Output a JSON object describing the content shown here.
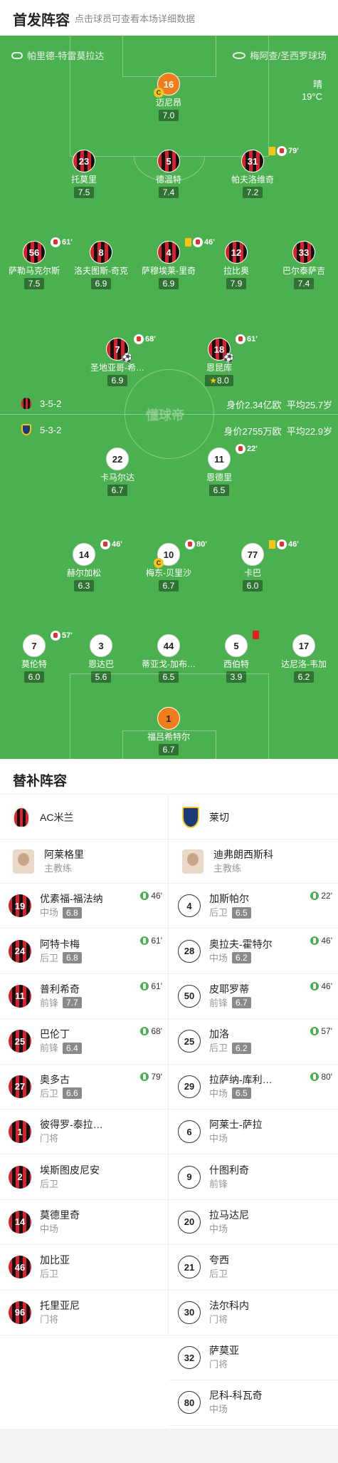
{
  "header": {
    "title": "首发阵容",
    "subtitle": "点击球员可查看本场详细数据"
  },
  "venue": {
    "referee": "帕里德-特雷莫拉达",
    "stadium": "梅阿查/圣西罗球场"
  },
  "weather": {
    "condition": "晴",
    "temp": "19°C"
  },
  "watermark": "懂球帝",
  "teams": {
    "home": {
      "formation": "3-5-2",
      "value": "身价2.34亿欧",
      "age": "平均25.7岁"
    },
    "away": {
      "formation": "5-3-2",
      "value": "身价2755万欧",
      "age": "平均22.9岁"
    }
  },
  "home_players": [
    {
      "num": "16",
      "name": "迈尼昂",
      "rating": "7.0"
    },
    {
      "num": "23",
      "name": "托莫里",
      "rating": "7.5"
    },
    {
      "num": "5",
      "name": "德温特",
      "rating": "7.4"
    },
    {
      "num": "31",
      "name": "帕夫洛维奇",
      "rating": "7.2",
      "min": "79'"
    },
    {
      "num": "56",
      "name": "萨勒马克尔斯",
      "rating": "7.5",
      "min": "61'"
    },
    {
      "num": "8",
      "name": "洛夫图斯-奇克",
      "rating": "6.9"
    },
    {
      "num": "4",
      "name": "萨穆埃莱-里奇",
      "rating": "6.9",
      "min": "46'"
    },
    {
      "num": "12",
      "name": "拉比奥",
      "rating": "7.9"
    },
    {
      "num": "33",
      "name": "巴尔泰萨吉",
      "rating": "7.4"
    },
    {
      "num": "7",
      "name": "圣地亚哥-希…",
      "rating": "6.9",
      "min": "68'"
    },
    {
      "num": "18",
      "name": "恩昆库",
      "rating": "8.0",
      "min": "61'"
    }
  ],
  "away_players": [
    {
      "num": "22",
      "name": "卡马尔达",
      "rating": "6.7"
    },
    {
      "num": "11",
      "name": "恩德里",
      "rating": "6.5",
      "min": "22'"
    },
    {
      "num": "14",
      "name": "赫尔加松",
      "rating": "6.3",
      "min": "46'"
    },
    {
      "num": "10",
      "name": "梅东-贝里沙",
      "rating": "6.7",
      "min": "80'"
    },
    {
      "num": "77",
      "name": "卡巴",
      "rating": "6.0",
      "min": "46'"
    },
    {
      "num": "7",
      "name": "莫伦特",
      "rating": "6.0",
      "min": "57'"
    },
    {
      "num": "3",
      "name": "恩达巴",
      "rating": "5.6"
    },
    {
      "num": "44",
      "name": "蒂亚戈-加布…",
      "rating": "6.5"
    },
    {
      "num": "5",
      "name": "西伯特",
      "rating": "3.9"
    },
    {
      "num": "17",
      "name": "达尼洛-韦加",
      "rating": "6.2"
    },
    {
      "num": "1",
      "name": "福吕希特尔",
      "rating": "6.7"
    }
  ],
  "subs": {
    "title": "替补阵容",
    "home_team": "AC米兰",
    "away_team": "莱切",
    "home_coach": {
      "name": "阿莱格里",
      "role": "主教练"
    },
    "away_coach": {
      "name": "迪弗朗西斯科",
      "role": "主教练"
    },
    "home": [
      {
        "num": "19",
        "name": "优素福-福法纳",
        "pos": "中场",
        "rating": "6.8",
        "min": "46'"
      },
      {
        "num": "24",
        "name": "阿特卡梅",
        "pos": "后卫",
        "rating": "6.8",
        "min": "61'"
      },
      {
        "num": "11",
        "name": "普利希奇",
        "pos": "前锋",
        "rating": "7.7",
        "min": "61'"
      },
      {
        "num": "25",
        "name": "巴伦丁",
        "pos": "前锋",
        "rating": "6.4",
        "min": "68'"
      },
      {
        "num": "27",
        "name": "奥多古",
        "pos": "后卫",
        "rating": "6.6",
        "min": "79'"
      },
      {
        "num": "1",
        "name": "彼得罗-泰拉…",
        "pos": "门将"
      },
      {
        "num": "2",
        "name": "埃斯图皮尼安",
        "pos": "后卫"
      },
      {
        "num": "14",
        "name": "莫德里奇",
        "pos": "中场"
      },
      {
        "num": "46",
        "name": "加比亚",
        "pos": "后卫"
      },
      {
        "num": "96",
        "name": "托里亚尼",
        "pos": "门将"
      }
    ],
    "away": [
      {
        "num": "4",
        "name": "加斯帕尔",
        "pos": "后卫",
        "rating": "6.5",
        "min": "22'"
      },
      {
        "num": "28",
        "name": "奥拉夫-霍特尔",
        "pos": "中场",
        "rating": "6.2",
        "min": "46'"
      },
      {
        "num": "50",
        "name": "皮耶罗蒂",
        "pos": "前锋",
        "rating": "6.7",
        "min": "46'"
      },
      {
        "num": "25",
        "name": "加洛",
        "pos": "后卫",
        "rating": "6.2",
        "min": "57'"
      },
      {
        "num": "29",
        "name": "拉萨纳-库利…",
        "pos": "中场",
        "rating": "6.5",
        "min": "80'"
      },
      {
        "num": "6",
        "name": "阿莱士-萨拉",
        "pos": "中场"
      },
      {
        "num": "9",
        "name": "什图利奇",
        "pos": "前锋"
      },
      {
        "num": "20",
        "name": "拉马达尼",
        "pos": "中场"
      },
      {
        "num": "21",
        "name": "夸西",
        "pos": "后卫"
      },
      {
        "num": "30",
        "name": "法尔科内",
        "pos": "门将"
      },
      {
        "num": "32",
        "name": "萨莫亚",
        "pos": "门将"
      },
      {
        "num": "80",
        "name": "尼科-科瓦奇",
        "pos": "中场"
      }
    ]
  }
}
